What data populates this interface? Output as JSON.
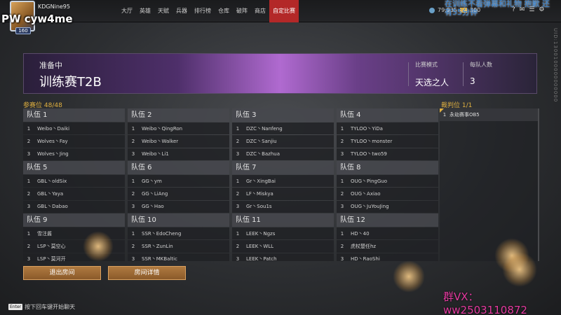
{
  "topbar": {
    "username": "KDGNine95",
    "avatar_level": "160",
    "overlay_left": "PW   cyw4me",
    "nav": [
      "大厅",
      "英雄",
      "天赋",
      "兵器",
      "排行榜",
      "仓库",
      "破阵",
      "商店",
      "自定比赛"
    ],
    "active_nav": "自定比赛",
    "coins": "79,935",
    "gold": "300",
    "overlay_right": "在训练不看弹幕和礼物 抱歉 还有55分钟",
    "side_text": "UID:1300100000000000"
  },
  "banner": {
    "status": "准备中",
    "title": "训练赛T2B",
    "mode_label": "比赛模式",
    "mode_value": "天选之人",
    "per_team_label": "每队人数",
    "per_team_value": "3"
  },
  "participants_label": "参赛位 48/48",
  "teams": [
    {
      "name": "队伍 1",
      "members": [
        "Weibo丶Daiki",
        "Wolves丶Fay",
        "Wolves丶Jing"
      ]
    },
    {
      "name": "队伍 2",
      "members": [
        "Weibo丶QingRon",
        "Weibo丶Walker",
        "Weibo丶Li1"
      ]
    },
    {
      "name": "队伍 3",
      "members": [
        "DZC丶Nanfeng",
        "DZC丶Sanjiu",
        "DZC丶Bazhua"
      ]
    },
    {
      "name": "队伍 4",
      "members": [
        "TYLOO丶YiDa",
        "TYLOO丶monster",
        "TYLOO丶two59"
      ]
    },
    {
      "name": "队伍 5",
      "members": [
        "GBL丶oldSix",
        "GBL丶Yaya",
        "GBL丶Dabao"
      ]
    },
    {
      "name": "队伍 6",
      "members": [
        "GG丶ym",
        "GG丶LiAng",
        "GG丶Hao"
      ]
    },
    {
      "name": "队伍 7",
      "members": [
        "Gr丶XingBai",
        "LF丶Miskya",
        "Gr丶Sou1s"
      ]
    },
    {
      "name": "队伍 8",
      "members": [
        "OUG丶PingGuo",
        "OUG丶Axiao",
        "OUG丶JuYouJing"
      ]
    },
    {
      "name": "队伍 9",
      "members": [
        "雪注酱",
        "LSP丶莫空心",
        "LSP丶莫河开"
      ]
    },
    {
      "name": "队伍 10",
      "members": [
        "SSR丶EdoCheng",
        "SSR丶ZunLin",
        "SSR丶MKBaltic"
      ]
    },
    {
      "name": "队伍 11",
      "members": [
        "LEEK丶Ngzs",
        "LEEK丶WLL",
        "LEEK丶Patch"
      ]
    },
    {
      "name": "队伍 12",
      "members": [
        "HD丶40",
        "虎杖楚任hz",
        "HD丶RaoShi"
      ]
    }
  ],
  "referee_label": "裁判位 1/1",
  "referee": {
    "num": "1",
    "name": "永劫赛事OB5"
  },
  "buttons": {
    "leave": "退出房间",
    "details": "房间详情"
  },
  "chat_hint": {
    "key": "Enter",
    "text": "按下回车键开始聊天"
  },
  "watermark": "群VX：ww2503110872",
  "colors": {
    "accent": "#b32828",
    "gold_text": "#e0b040",
    "button": "#9a6a35"
  }
}
